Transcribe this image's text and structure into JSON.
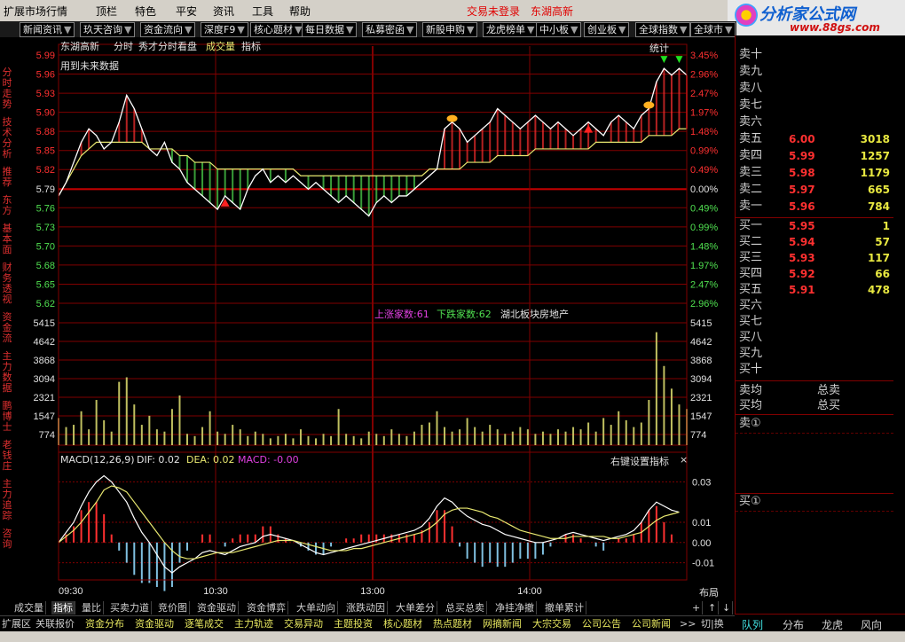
{
  "menubar": {
    "items": [
      "扩展市场行情",
      "顶栏",
      "特色",
      "平安",
      "资讯",
      "工具",
      "帮助"
    ],
    "status_trade": "交易未登录",
    "status_stock": "东湖高新"
  },
  "logo": {
    "name": "分析家公式网",
    "url": "www.88gs.com"
  },
  "toptabs": [
    "新闻资讯",
    "玖天咨询",
    "资金流向",
    "深度F9",
    "核心题材",
    "每日数据",
    "私募密函",
    "新股申购",
    "龙虎榜单",
    "中小板",
    "创业板",
    "全球指数",
    "全球市"
  ],
  "leftbar": [
    "分时走势",
    "技术分析",
    "推荐",
    "东方",
    "基本面",
    "财务透视",
    "资金流",
    "主力数据",
    "鹏博士",
    "老钱庄",
    "主力追踪",
    "咨询"
  ],
  "chart": {
    "stock_name": "东湖高新",
    "tabs": [
      "分时",
      "秀才分时看盘",
      "成交量",
      "指标"
    ],
    "stat_label": "统计",
    "future_note": "用到未来数据",
    "market_info": {
      "up_label": "上涨家数:61",
      "down_label": "下跌家数:62",
      "sector": "湖北板块房地产"
    },
    "price_ticks": [
      "5.99",
      "5.96",
      "5.93",
      "5.90",
      "5.88",
      "5.85",
      "5.82",
      "5.79",
      "5.76",
      "5.73",
      "5.70",
      "5.68",
      "5.65",
      "5.62"
    ],
    "pct_ticks": [
      "3.45%",
      "2.96%",
      "2.47%",
      "1.97%",
      "1.48%",
      "0.99%",
      "0.49%",
      "0.00%",
      "0.49%",
      "0.99%",
      "1.48%",
      "1.97%",
      "2.47%",
      "2.96%"
    ],
    "vol_ticks": [
      "5415",
      "4642",
      "3868",
      "3094",
      "2321",
      "1547",
      "774"
    ],
    "macd_header": {
      "name": "MACD(12,26,9)",
      "dif": "DIF: 0.02",
      "dea": "DEA: 0.02",
      "macd": "MACD: -0.00",
      "setting": "右键设置指标"
    },
    "macd_ticks": [
      "0.03",
      "0.01",
      "0.00",
      "-0.01"
    ],
    "time_ticks": [
      "09:30",
      "10:30",
      "13:00",
      "14:00"
    ],
    "layout_btn": "布局",
    "colors": {
      "up": "#ff3030",
      "down": "#50e050",
      "grid": "#800000",
      "price_line": "#ffffff",
      "avg_line": "#e8e870",
      "volume": "#c0c060",
      "macd_neg": "#80c0e0"
    }
  },
  "chart_data": {
    "type": "line",
    "title": "东湖高新",
    "series": [
      {
        "name": "分时",
        "ylim": [
          5.62,
          5.99
        ],
        "prev_close": 5.79,
        "values": [
          5.78,
          5.8,
          5.83,
          5.86,
          5.88,
          5.87,
          5.85,
          5.86,
          5.89,
          5.93,
          5.91,
          5.88,
          5.85,
          5.84,
          5.86,
          5.83,
          5.82,
          5.8,
          5.79,
          5.78,
          5.77,
          5.76,
          5.78,
          5.77,
          5.76,
          5.79,
          5.81,
          5.82,
          5.8,
          5.81,
          5.8,
          5.81,
          5.8,
          5.79,
          5.8,
          5.79,
          5.78,
          5.77,
          5.78,
          5.77,
          5.76,
          5.75,
          5.77,
          5.78,
          5.77,
          5.78,
          5.78,
          5.79,
          5.8,
          5.81,
          5.82,
          5.88,
          5.89,
          5.88,
          5.86,
          5.87,
          5.88,
          5.89,
          5.91,
          5.9,
          5.89,
          5.88,
          5.89,
          5.9,
          5.89,
          5.88,
          5.89,
          5.88,
          5.87,
          5.88,
          5.89,
          5.88,
          5.87,
          5.89,
          5.9,
          5.89,
          5.88,
          5.9,
          5.91,
          5.95,
          5.97,
          5.96,
          5.97,
          5.96
        ]
      },
      {
        "name": "均价",
        "values": [
          5.78,
          5.8,
          5.82,
          5.84,
          5.85,
          5.86,
          5.86,
          5.86,
          5.86,
          5.86,
          5.86,
          5.86,
          5.85,
          5.85,
          5.85,
          5.85,
          5.84,
          5.84,
          5.83,
          5.83,
          5.83,
          5.82,
          5.82,
          5.82,
          5.82,
          5.82,
          5.82,
          5.82,
          5.82,
          5.82,
          5.82,
          5.82,
          5.81,
          5.81,
          5.81,
          5.81,
          5.81,
          5.81,
          5.81,
          5.81,
          5.81,
          5.81,
          5.81,
          5.81,
          5.81,
          5.81,
          5.81,
          5.81,
          5.81,
          5.82,
          5.82,
          5.82,
          5.82,
          5.82,
          5.83,
          5.83,
          5.83,
          5.83,
          5.84,
          5.84,
          5.84,
          5.84,
          5.84,
          5.85,
          5.85,
          5.85,
          5.85,
          5.85,
          5.85,
          5.85,
          5.85,
          5.86,
          5.86,
          5.86,
          5.86,
          5.86,
          5.86,
          5.86,
          5.87,
          5.87,
          5.87,
          5.87,
          5.88,
          5.88
        ]
      },
      {
        "name": "成交量",
        "ylim": [
          0,
          5415
        ],
        "values": [
          1200,
          800,
          900,
          1500,
          700,
          2000,
          1100,
          600,
          2800,
          3000,
          1800,
          900,
          1300,
          700,
          600,
          1600,
          2200,
          500,
          400,
          800,
          1500,
          600,
          500,
          900,
          700,
          400,
          600,
          500,
          300,
          400,
          500,
          300,
          700,
          400,
          300,
          500,
          400,
          1600,
          500,
          400,
          300,
          600,
          500,
          400,
          700,
          500,
          400,
          600,
          900,
          1000,
          1500,
          800,
          600,
          700,
          1200,
          800,
          600,
          900,
          700,
          500,
          600,
          800,
          700,
          500,
          600,
          500,
          700,
          600,
          800,
          700,
          1000,
          600,
          1200,
          900,
          1500,
          1100,
          800,
          1000,
          2000,
          5000,
          3500,
          2500,
          1800,
          1600
        ]
      },
      {
        "name": "MACD",
        "ylim": [
          -0.015,
          0.035
        ],
        "dif": [
          0.0,
          0.005,
          0.01,
          0.018,
          0.025,
          0.03,
          0.033,
          0.03,
          0.025,
          0.02,
          0.012,
          0.005,
          0.0,
          -0.006,
          -0.012,
          -0.015,
          -0.012,
          -0.01,
          -0.008,
          -0.005,
          -0.004,
          -0.005,
          -0.006,
          -0.004,
          -0.002,
          -0.001,
          0.0,
          0.003,
          0.004,
          0.003,
          0.002,
          0.001,
          -0.001,
          -0.003,
          -0.005,
          -0.006,
          -0.005,
          -0.004,
          -0.003,
          -0.002,
          -0.001,
          0.0,
          0.001,
          0.002,
          0.003,
          0.004,
          0.005,
          0.006,
          0.008,
          0.012,
          0.018,
          0.022,
          0.02,
          0.016,
          0.013,
          0.011,
          0.009,
          0.008,
          0.006,
          0.004,
          0.003,
          0.002,
          0.001,
          0.0,
          0.0,
          0.001,
          0.002,
          0.004,
          0.005,
          0.004,
          0.003,
          0.002,
          0.001,
          0.002,
          0.003,
          0.004,
          0.006,
          0.01,
          0.016,
          0.02,
          0.018,
          0.016,
          0.015
        ],
        "dea": [
          0.0,
          0.003,
          0.006,
          0.01,
          0.015,
          0.02,
          0.026,
          0.028,
          0.027,
          0.025,
          0.02,
          0.015,
          0.01,
          0.005,
          0.0,
          -0.004,
          -0.007,
          -0.008,
          -0.008,
          -0.007,
          -0.006,
          -0.005,
          -0.005,
          -0.005,
          -0.004,
          -0.003,
          -0.002,
          -0.001,
          0.0,
          0.001,
          0.001,
          0.001,
          0.0,
          -0.001,
          -0.002,
          -0.003,
          -0.004,
          -0.004,
          -0.004,
          -0.003,
          -0.003,
          -0.002,
          -0.001,
          0.0,
          0.001,
          0.002,
          0.003,
          0.004,
          0.005,
          0.007,
          0.01,
          0.014,
          0.016,
          0.017,
          0.017,
          0.016,
          0.015,
          0.013,
          0.012,
          0.01,
          0.008,
          0.006,
          0.005,
          0.004,
          0.003,
          0.002,
          0.002,
          0.002,
          0.003,
          0.003,
          0.003,
          0.003,
          0.003,
          0.002,
          0.002,
          0.003,
          0.004,
          0.005,
          0.008,
          0.011,
          0.013,
          0.014,
          0.015
        ]
      }
    ]
  },
  "orderbook": {
    "sell_labels": [
      "卖十",
      "卖九",
      "卖八",
      "卖七",
      "卖六",
      "卖五",
      "卖四",
      "卖三",
      "卖二",
      "卖一"
    ],
    "buy_labels": [
      "买一",
      "买二",
      "买三",
      "买四",
      "买五",
      "买六",
      "买七",
      "买八",
      "买九",
      "买十"
    ],
    "sell_prices": [
      "",
      "",
      "",
      "",
      "",
      "6.00",
      "5.99",
      "5.98",
      "5.97",
      "5.96"
    ],
    "sell_vols": [
      "",
      "",
      "",
      "",
      "",
      "3018",
      "1257",
      "1179",
      "665",
      "784"
    ],
    "buy_prices": [
      "5.95",
      "5.94",
      "5.93",
      "5.92",
      "5.91",
      "",
      "",
      "",
      "",
      ""
    ],
    "buy_vols": [
      "1",
      "57",
      "117",
      "66",
      "478",
      "",
      "",
      "",
      "",
      ""
    ],
    "avg_sell": "卖均",
    "total_sell": "总卖",
    "avg_buy": "买均",
    "total_buy": "总买",
    "sell_queue": "卖①",
    "buy_queue": "买①"
  },
  "bottomtabs": [
    "成交量",
    "指标",
    "量比",
    "买卖力道",
    "竞价图",
    "资金驱动",
    "资金博弈",
    "大单动向",
    "涨跌动因",
    "大单差分",
    "总买总卖",
    "净挂净撤",
    "撤单累计"
  ],
  "statusbar": [
    "扩展区",
    "关联报价",
    "资金分布",
    "资金驱动",
    "逐笔成交",
    "主力轨迹",
    "交易异动",
    "主题投资",
    "核心题材",
    "热点题材",
    "网摘新闻",
    "大宗交易",
    "公司公告",
    "公司新闻"
  ],
  "rightbottom": [
    "队列",
    "分布",
    "龙虎",
    "风向"
  ],
  "nav": {
    "more": ">>",
    "switch": "切|换"
  }
}
